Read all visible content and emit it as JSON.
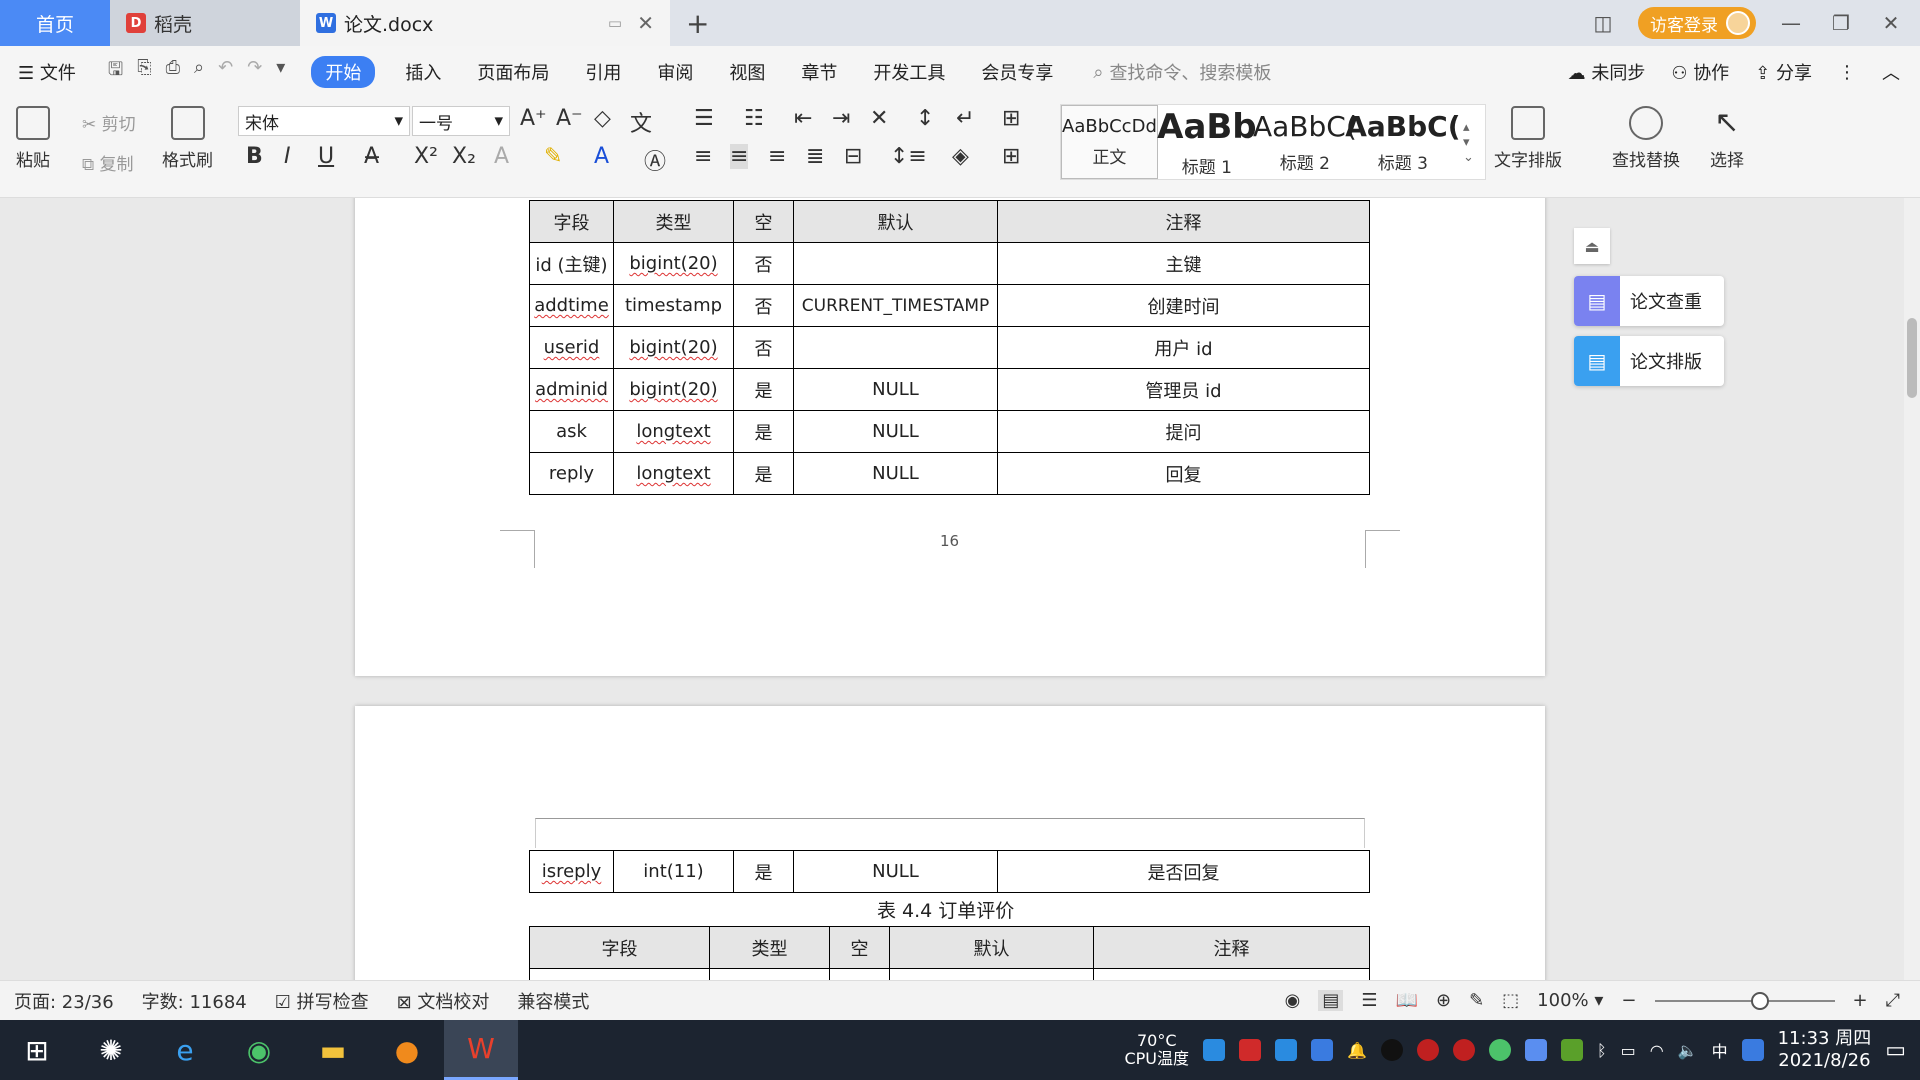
{
  "tabs": {
    "home": "首页",
    "daoke": "稻壳",
    "doc": "论文.docx",
    "login": "访客登录"
  },
  "menu": {
    "file": "文件",
    "items": [
      "开始",
      "插入",
      "页面布局",
      "引用",
      "审阅",
      "视图",
      "章节",
      "开发工具",
      "会员专享"
    ],
    "search_placeholder": "查找命令、搜索模板",
    "right": [
      "未同步",
      "协作",
      "分享"
    ]
  },
  "ribbon": {
    "paste": "粘贴",
    "cut": "剪切",
    "copy": "复制",
    "format_painter": "格式刷",
    "font": "宋体",
    "size": "一号",
    "styles": [
      {
        "preview": "AaBbCcDd",
        "name": "正文"
      },
      {
        "preview": "AaBb",
        "name": "标题 1"
      },
      {
        "preview": "AaBbC(",
        "name": "标题 2"
      },
      {
        "preview": "AaBbC(",
        "name": "标题 3"
      }
    ],
    "text_layout": "文字排版",
    "find_replace": "查找替换",
    "select": "选择"
  },
  "table1": {
    "headers": [
      "字段",
      "类型",
      "空",
      "默认",
      "注释"
    ],
    "rows": [
      [
        "id (主键)",
        "bigint(20)",
        "否",
        "",
        "主键"
      ],
      [
        "addtime",
        "timestamp",
        "否",
        "CURRENT_TIMESTAMP",
        "创建时间"
      ],
      [
        "userid",
        "bigint(20)",
        "否",
        "",
        "用户 id"
      ],
      [
        "adminid",
        "bigint(20)",
        "是",
        "NULL",
        "管理员 id"
      ],
      [
        "ask",
        "longtext",
        "是",
        "NULL",
        "提问"
      ],
      [
        "reply",
        "longtext",
        "是",
        "NULL",
        "回复"
      ]
    ]
  },
  "page_number": "16",
  "table2": {
    "rows": [
      [
        "isreply",
        "int(11)",
        "是",
        "NULL",
        "是否回复"
      ]
    ]
  },
  "caption": "表 4.4  订单评价",
  "table3": {
    "headers": [
      "字段",
      "类型",
      "空",
      "默认",
      "注释"
    ]
  },
  "side": {
    "check": "论文查重",
    "layout": "论文排版"
  },
  "status": {
    "page": "页面: 23/36",
    "words": "字数: 11684",
    "spell": "拼写检查",
    "proof": "文档校对",
    "compat": "兼容模式",
    "zoom": "100%"
  },
  "taskbar": {
    "temp": "70°C",
    "cpu": "CPU温度",
    "time": "11:33 周四",
    "date": "2021/8/26",
    "ime": "中"
  }
}
